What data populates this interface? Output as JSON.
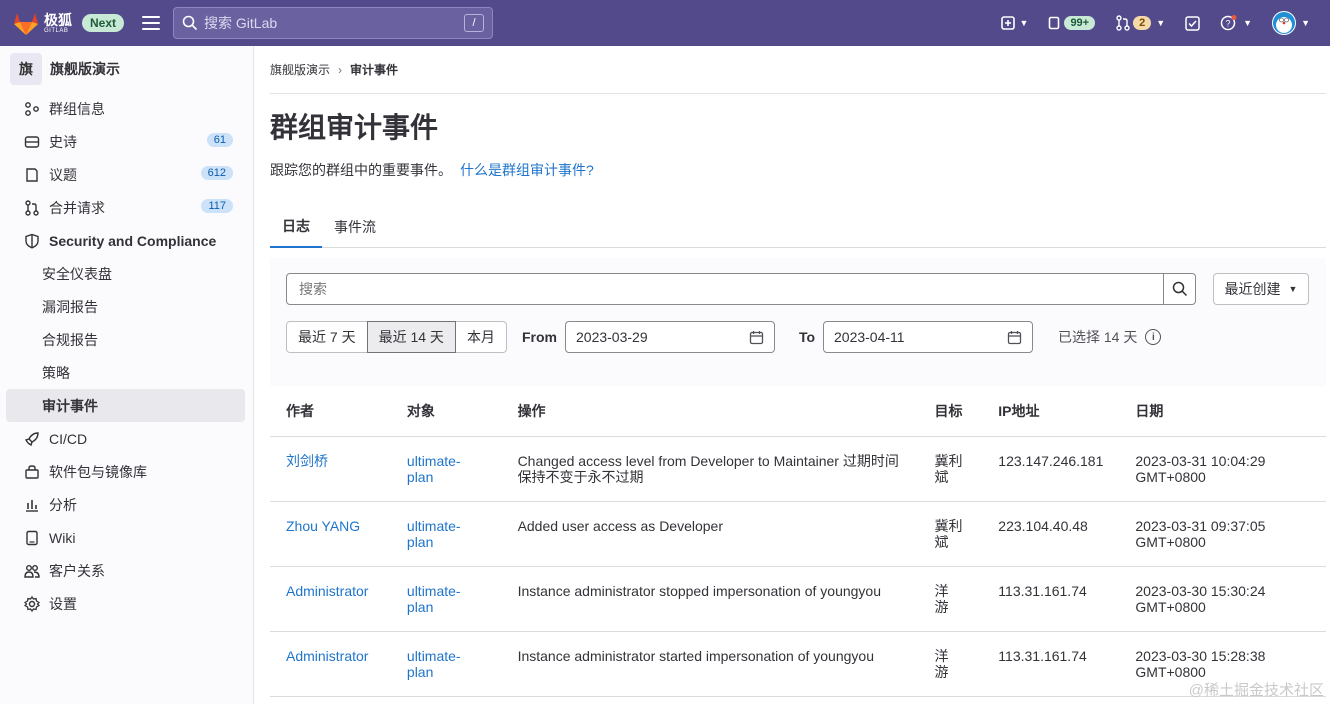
{
  "topbar": {
    "brand_name": "极狐",
    "brand_sub": "GITLAB",
    "next_badge": "Next",
    "search_placeholder": "搜索 GitLab",
    "search_shortcut": "/",
    "issues_count": "99+",
    "mr_count": "2",
    "brand_color": "#524a8b"
  },
  "sidebar": {
    "group_initial": "旗",
    "group_name": "旗舰版演示",
    "items": [
      {
        "label": "群组信息",
        "icon": "group-info-icon"
      },
      {
        "label": "史诗",
        "icon": "epic-icon",
        "count": "61"
      },
      {
        "label": "议题",
        "icon": "issues-icon",
        "count": "612"
      },
      {
        "label": "合并请求",
        "icon": "merge-request-icon",
        "count": "117"
      },
      {
        "label": "Security and Compliance",
        "icon": "shield-icon"
      },
      {
        "label": "CI/CD",
        "icon": "rocket-icon"
      },
      {
        "label": "软件包与镜像库",
        "icon": "package-icon"
      },
      {
        "label": "分析",
        "icon": "chart-icon"
      },
      {
        "label": "Wiki",
        "icon": "book-icon"
      },
      {
        "label": "客户关系",
        "icon": "users-icon"
      },
      {
        "label": "设置",
        "icon": "gear-icon"
      }
    ],
    "sub_items": [
      "安全仪表盘",
      "漏洞报告",
      "合规报告",
      "策略",
      "审计事件"
    ]
  },
  "breadcrumb": {
    "parent": "旗舰版演示",
    "separator": "›",
    "current": "审计事件"
  },
  "page": {
    "title": "群组审计事件",
    "description": "跟踪您的群组中的重要事件。",
    "help_link": "什么是群组审计事件?"
  },
  "tabs": [
    "日志",
    "事件流"
  ],
  "filters": {
    "search_placeholder": "搜索",
    "sort_label": "最近创建",
    "range_buttons": [
      "最近 7 天",
      "最近 14 天",
      "本月"
    ],
    "selected_range": "最近 14 天",
    "from_label": "From",
    "from_value": "2023-03-29",
    "to_label": "To",
    "to_value": "2023-04-11",
    "selected_days": "已选择 14 天"
  },
  "table": {
    "headers": [
      "作者",
      "对象",
      "操作",
      "目标",
      "IP地址",
      "日期"
    ],
    "rows": [
      {
        "author": "刘剑桥",
        "object": "ultimate-plan",
        "action": "Changed access level from Developer to Maintainer 过期时间保持不变于永不过期",
        "target": "冀利斌",
        "ip": "123.147.246.181",
        "date": "2023-03-31 10:04:29 GMT+0800"
      },
      {
        "author": "Zhou YANG",
        "object": "ultimate-plan",
        "action": "Added user access as Developer",
        "target": "冀利斌",
        "ip": "223.104.40.48",
        "date": "2023-03-31 09:37:05 GMT+0800"
      },
      {
        "author": "Administrator",
        "object": "ultimate-plan",
        "action": "Instance administrator stopped impersonation of youngyou",
        "target": "洋 游",
        "ip": "113.31.161.74",
        "date": "2023-03-30 15:30:24 GMT+0800"
      },
      {
        "author": "Administrator",
        "object": "ultimate-plan",
        "action": "Instance administrator started impersonation of youngyou",
        "target": "洋 游",
        "ip": "113.31.161.74",
        "date": "2023-03-30 15:28:38 GMT+0800"
      }
    ]
  },
  "watermark": "@稀土掘金技术社区"
}
